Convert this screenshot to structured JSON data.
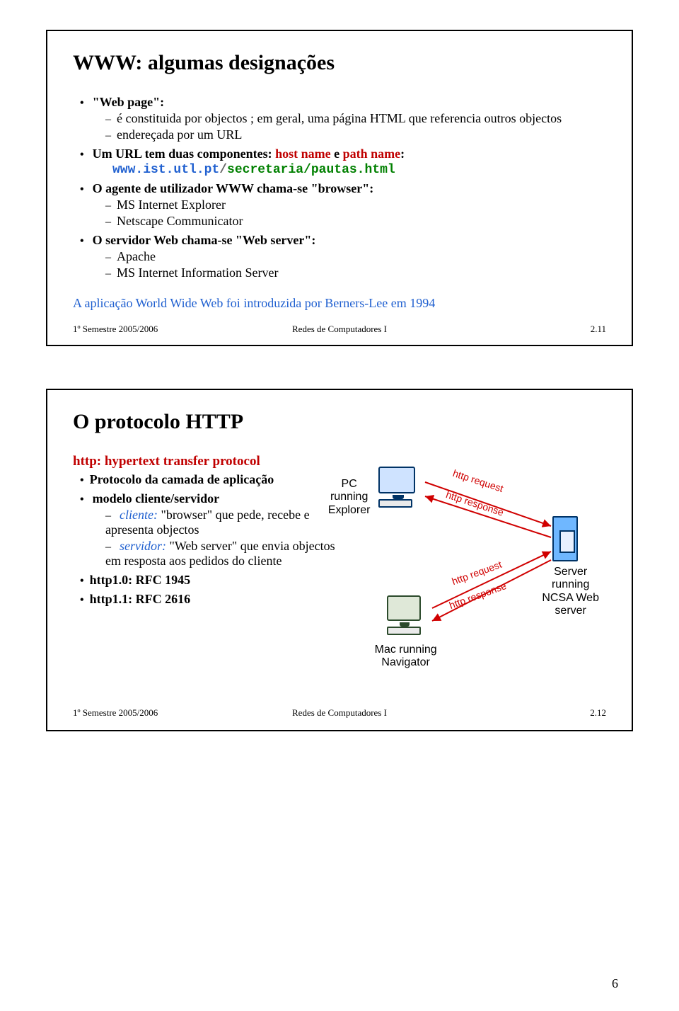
{
  "slide1": {
    "title": "WWW: algumas designações",
    "bullets": [
      {
        "text_prefix": "\"Web page\":",
        "sub": [
          "é constituida por objectos ; em geral, uma página HTML que referencia outros objectos",
          "endereçada por um URL"
        ]
      },
      {
        "text_parts": {
          "pre": "Um URL tem duas componentes: ",
          "red1": "host name",
          "mid": " e ",
          "red2": "path name",
          "post": ":"
        },
        "code": {
          "host": "www.ist.utl.pt",
          "sep": "/",
          "path": "secretaria/pautas.html"
        }
      },
      {
        "text_prefix": "O agente de utilizador WWW chama-se \"browser\":",
        "sub": [
          "MS Internet Explorer",
          "Netscape Communicator"
        ]
      },
      {
        "text_prefix": "O servidor Web chama-se \"Web server\":",
        "sub": [
          "Apache",
          "MS Internet Information Server"
        ]
      }
    ],
    "footnote": "A aplicação World Wide Web foi introduzida por Berners-Lee em 1994",
    "footer": {
      "left": "1º Semestre 2005/2006",
      "center": "Redes de Computadores I",
      "right": "2.11"
    }
  },
  "slide2": {
    "title": "O protocolo HTTP",
    "sub": "http: hypertext transfer protocol",
    "bullets": [
      {
        "text": "Protocolo da camada de aplicação"
      },
      {
        "text": "modelo cliente/servidor",
        "sub": [
          {
            "ital": "cliente:",
            "rest": " \"browser\" que pede, recebe e apresenta objectos"
          },
          {
            "ital": "servidor:",
            "rest": " \"Web server\" que envia objectos em resposta aos pedidos do cliente"
          }
        ]
      },
      {
        "text": "http1.0: RFC 1945"
      },
      {
        "text": "http1.1: RFC 2616"
      }
    ],
    "diagram": {
      "pc_label": "PC running Explorer",
      "mac_label": "Mac running Navigator",
      "server_label": "Server running NCSA Web server",
      "req": "http request",
      "resp": "http response"
    },
    "footer": {
      "left": "1º Semestre 2005/2006",
      "center": "Redes de Computadores I",
      "right": "2.12"
    }
  },
  "page_number": "6"
}
